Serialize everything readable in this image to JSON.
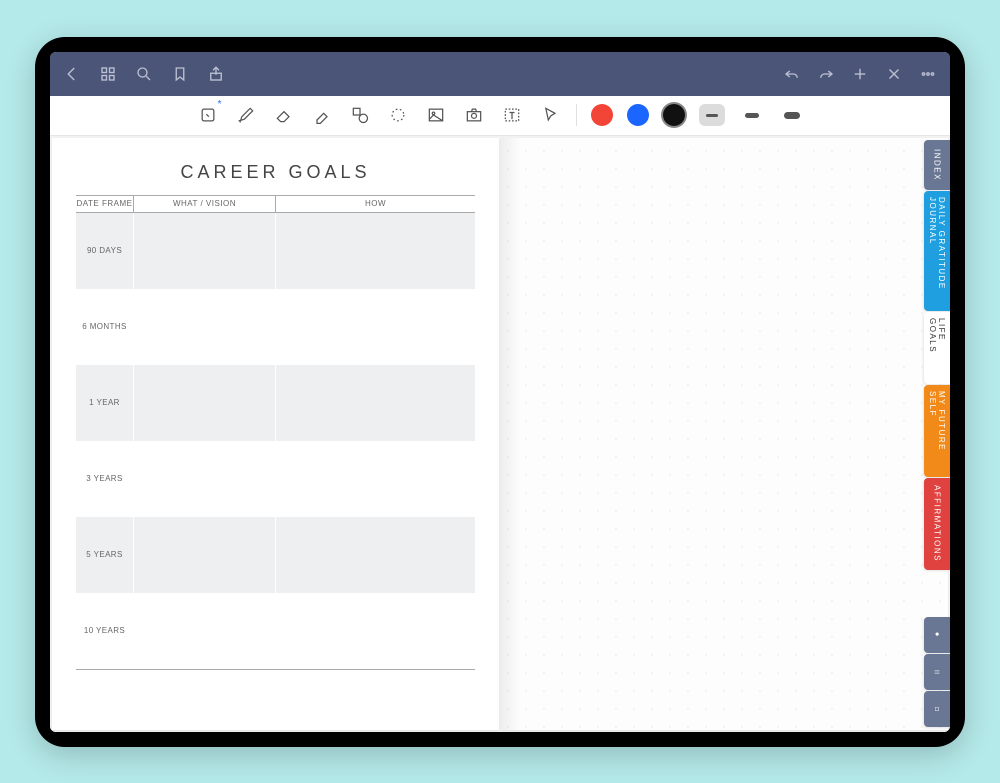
{
  "page": {
    "title": "CAREER GOALS",
    "headers": {
      "date_frame": "DATE FRAME",
      "what": "WHAT / VISION",
      "how": "HOW"
    },
    "rows": [
      {
        "label": "90 DAYS"
      },
      {
        "label": "6 MONTHS"
      },
      {
        "label": "1 YEAR"
      },
      {
        "label": "3 YEARS"
      },
      {
        "label": "5 YEARS"
      },
      {
        "label": "10 YEARS"
      }
    ]
  },
  "tabs": {
    "index": {
      "label": "INDEX",
      "color": "#6a7794"
    },
    "gratitude": {
      "label": "DAILY GRATITUDE JOURNAL",
      "color": "#1f9fe0"
    },
    "life_goals": {
      "label": "LIFE GOALS",
      "color": "#ffffff",
      "text": "#333"
    },
    "future": {
      "label": "MY FUTURE SELF",
      "color": "#f28a1a"
    },
    "affirm": {
      "label": "AFFIRMATIONS",
      "color": "#e0423f"
    }
  },
  "colors": {
    "red": "#f24437",
    "blue": "#1a66ff",
    "black": "#111"
  },
  "strokes": {
    "thin": 4,
    "med": 7,
    "thick": 9
  }
}
